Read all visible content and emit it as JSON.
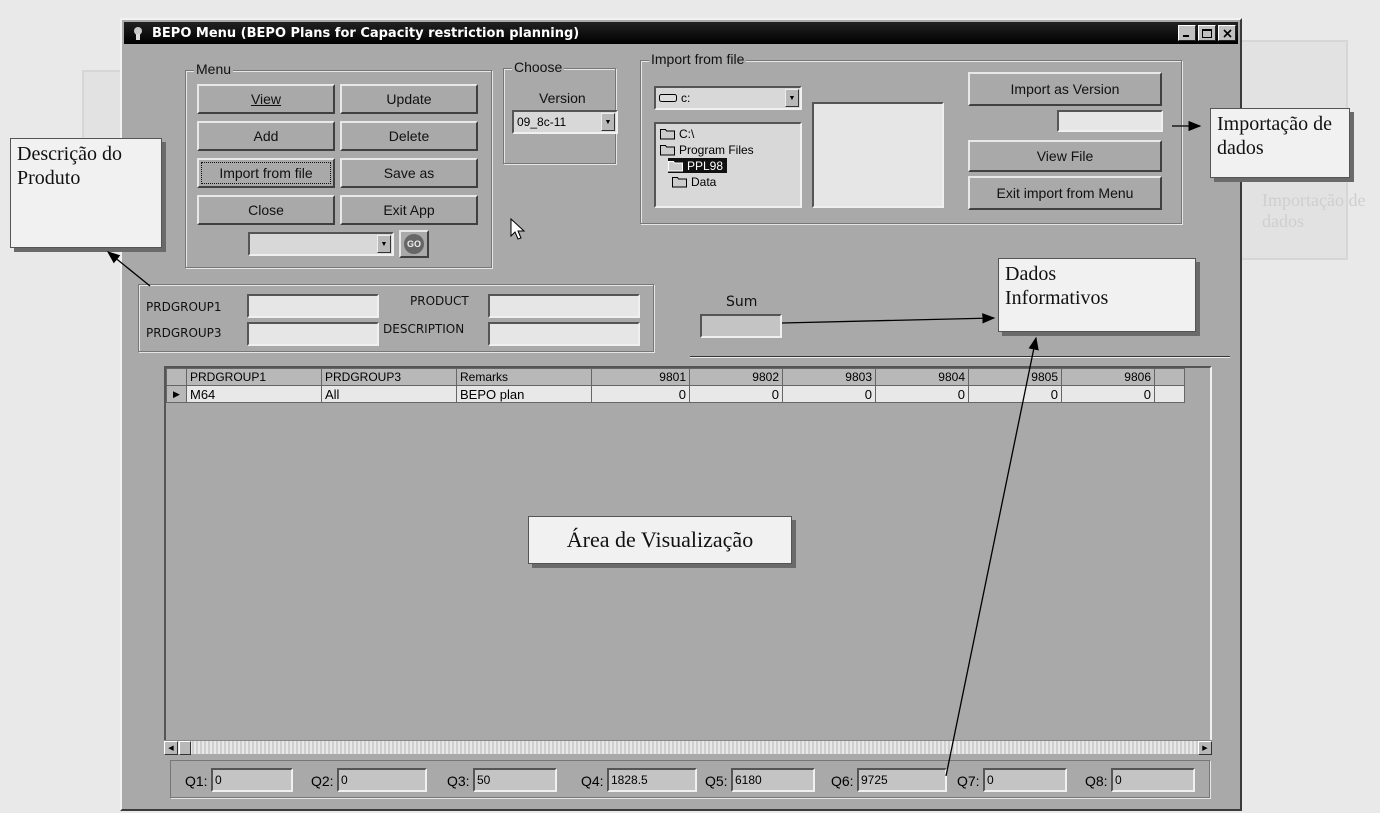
{
  "window": {
    "title": "BEPO Menu (BEPO Plans for Capacity restriction planning)"
  },
  "menu": {
    "title": "Menu",
    "view": "View",
    "update": "Update",
    "add": "Add",
    "delete": "Delete",
    "import_from_file": "Import from file",
    "save_as": "Save as",
    "close": "Close",
    "exit_app": "Exit App",
    "go_label": "GO"
  },
  "choose": {
    "title": "Choose",
    "version_label": "Version",
    "version_value": "09_8c-11"
  },
  "import": {
    "title": "Import from file",
    "drive": "c:",
    "dirs": [
      "C:\\",
      "Program Files",
      "PPL98",
      "Data"
    ],
    "selected_dir": "PPL98",
    "import_as_version": "Import as Version",
    "view_file": "View File",
    "exit_import": "Exit import from Menu"
  },
  "product": {
    "prdgroup1_label": "PRDGROUP1",
    "prdgroup3_label": "PRDGROUP3",
    "product_label": "PRODUCT",
    "description_label": "DESCRIPTION"
  },
  "sum": {
    "label": "Sum"
  },
  "grid": {
    "columns": [
      "PRDGROUP1",
      "PRDGROUP3",
      "Remarks",
      "9801",
      "9802",
      "9803",
      "9804",
      "9805",
      "9806"
    ],
    "rows": [
      [
        "M64",
        "All",
        "BEPO plan",
        "0",
        "0",
        "0",
        "0",
        "0",
        "0"
      ]
    ]
  },
  "status": {
    "q": [
      {
        "label": "Q1:",
        "value": "0"
      },
      {
        "label": "Q2:",
        "value": "0"
      },
      {
        "label": "Q3:",
        "value": "50"
      },
      {
        "label": "Q4:",
        "value": "1828.5"
      },
      {
        "label": "Q5:",
        "value": "6180"
      },
      {
        "label": "Q6:",
        "value": "9725"
      },
      {
        "label": "Q7:",
        "value": "0"
      },
      {
        "label": "Q8:",
        "value": "0"
      }
    ]
  },
  "callouts": {
    "descricao": "Descrição do Produto",
    "importacao": "Importação de dados",
    "dados": "Dados Informativos",
    "area": "Área de Visualização"
  }
}
